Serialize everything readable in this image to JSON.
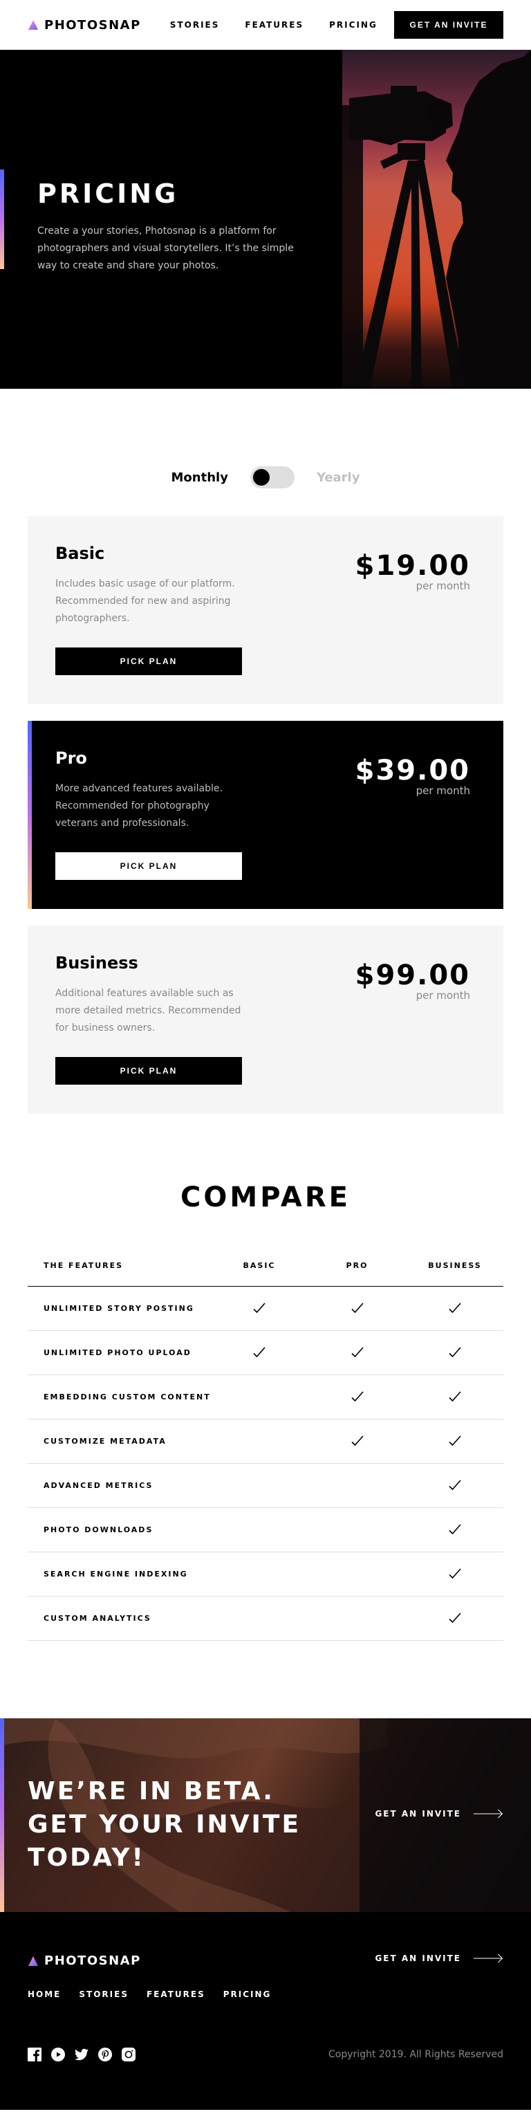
{
  "brand": {
    "name": "PHOTOSNAP"
  },
  "nav": {
    "items": [
      "STORIES",
      "FEATURES",
      "PRICING"
    ],
    "cta": "GET AN INVITE"
  },
  "hero": {
    "title": "PRICING",
    "description": "Create a your stories, Photosnap is a platform for photographers and visual storytellers. It’s the simple way to create and share your photos."
  },
  "billing": {
    "monthly": "Monthly",
    "yearly": "Yearly",
    "selected": "Monthly"
  },
  "plans": [
    {
      "name": "Basic",
      "description": "Includes basic usage of our platform. Recommended for new and aspiring photographers.",
      "price": "$19.00",
      "period": "per month",
      "button": "PICK PLAN"
    },
    {
      "name": "Pro",
      "description": "More advanced features available. Recommended for photography veterans and professionals.",
      "price": "$39.00",
      "period": "per month",
      "button": "PICK PLAN"
    },
    {
      "name": "Business",
      "description": "Additional features available such as more detailed metrics. Recommended for business owners.",
      "price": "$99.00",
      "period": "per month",
      "button": "PICK PLAN"
    }
  ],
  "compare": {
    "title": "COMPARE",
    "headers": [
      "THE FEATURES",
      "BASIC",
      "PRO",
      "BUSINESS"
    ],
    "rows": [
      {
        "feature": "UNLIMITED STORY POSTING",
        "basic": true,
        "pro": true,
        "business": true
      },
      {
        "feature": "UNLIMITED PHOTO UPLOAD",
        "basic": true,
        "pro": true,
        "business": true
      },
      {
        "feature": "EMBEDDING CUSTOM CONTENT",
        "basic": false,
        "pro": true,
        "business": true
      },
      {
        "feature": "CUSTOMIZE METADATA",
        "basic": false,
        "pro": true,
        "business": true
      },
      {
        "feature": "ADVANCED METRICS",
        "basic": false,
        "pro": false,
        "business": true
      },
      {
        "feature": "PHOTO DOWNLOADS",
        "basic": false,
        "pro": false,
        "business": true
      },
      {
        "feature": "SEARCH ENGINE INDEXING",
        "basic": false,
        "pro": false,
        "business": true
      },
      {
        "feature": "CUSTOM ANALYTICS",
        "basic": false,
        "pro": false,
        "business": true
      }
    ]
  },
  "beta": {
    "title": "WE’RE IN BETA. GET YOUR INVITE TODAY!",
    "link": "GET AN INVITE"
  },
  "footer": {
    "link": "GET AN INVITE",
    "nav": [
      "HOME",
      "STORIES",
      "FEATURES",
      "PRICING"
    ],
    "socials": [
      "facebook-icon",
      "youtube-icon",
      "twitter-icon",
      "pinterest-icon",
      "instagram-icon"
    ],
    "copyright": "Copyright 2019. All Rights Reserved"
  },
  "colors": {
    "accent_start": "#5165ff",
    "accent_mid": "#bb72ea",
    "accent_end": "#ffc593",
    "card_light": "#f5f5f5",
    "dark": "#000000"
  }
}
